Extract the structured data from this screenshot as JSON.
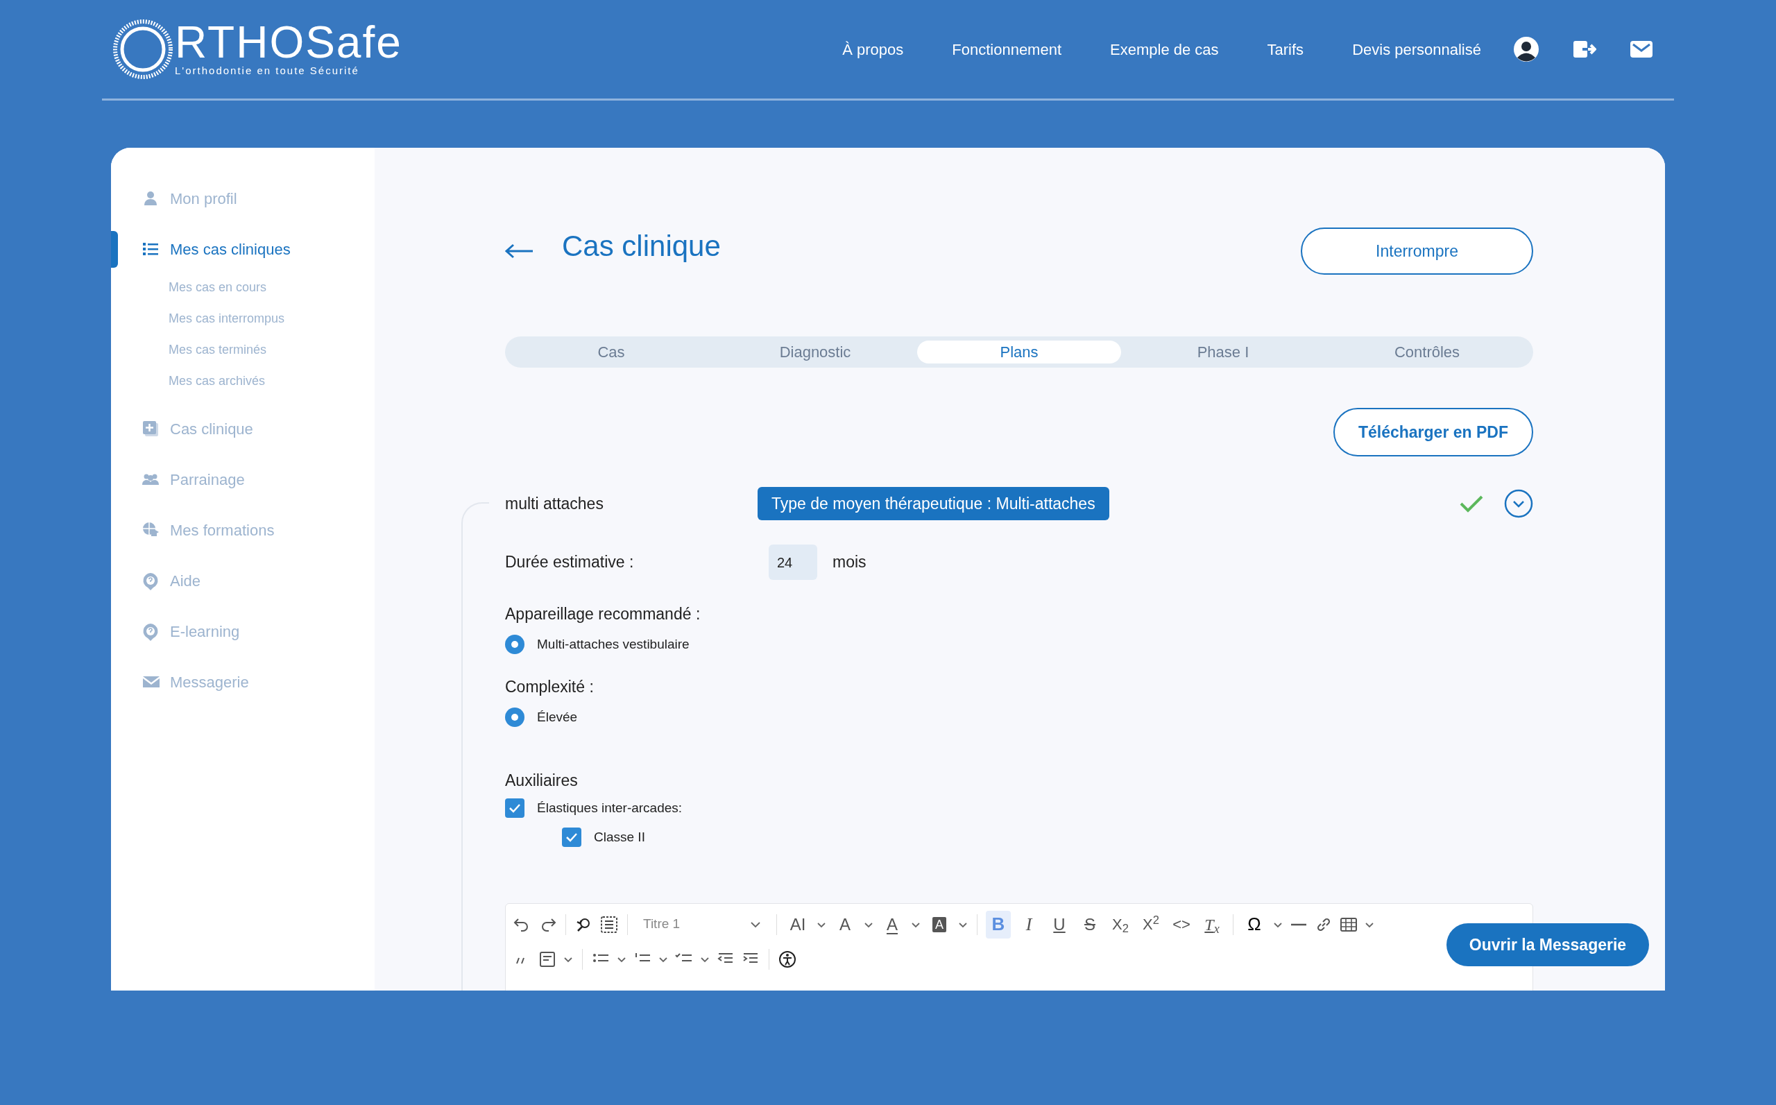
{
  "header": {
    "logo": {
      "name": "RTHOSafe",
      "tagline": "L'orthodontie en toute Sécurité"
    },
    "nav": [
      "À propos",
      "Fonctionnement",
      "Exemple de cas",
      "Tarifs",
      "Devis personnalisé"
    ]
  },
  "sidebar": {
    "items": [
      {
        "kind": "profile",
        "label": "Mon profil",
        "selected": false
      },
      {
        "kind": "cases",
        "label": "Mes cas cliniques",
        "selected": true,
        "children": [
          {
            "label": "Mes cas en cours"
          },
          {
            "label": "Mes cas interrompus"
          },
          {
            "label": "Mes cas terminés"
          },
          {
            "label": "Mes cas archivés"
          }
        ]
      },
      {
        "kind": "new-case",
        "label": "Cas clinique",
        "selected": false
      },
      {
        "kind": "referral",
        "label": "Parrainage",
        "selected": false
      },
      {
        "kind": "training",
        "label": "Mes formations",
        "selected": false
      },
      {
        "kind": "help",
        "label": "Aide",
        "selected": false
      },
      {
        "kind": "elearning",
        "label": "E-learning",
        "selected": false
      },
      {
        "kind": "messages",
        "label": "Messagerie",
        "selected": false
      }
    ]
  },
  "page": {
    "title": "Cas clinique",
    "interrupt_button": "Interrompre",
    "pdf_button": "Télécharger en PDF"
  },
  "tabs": [
    {
      "label": "Cas",
      "selected": false
    },
    {
      "label": "Diagnostic",
      "selected": false
    },
    {
      "label": "Plans",
      "selected": true
    },
    {
      "label": "Phase I",
      "selected": false
    },
    {
      "label": "Contrôles",
      "selected": false
    }
  ],
  "plan": {
    "title": "multi attaches",
    "badge": "Type de moyen thérapeutique : Multi-attaches",
    "validated": true,
    "duration": {
      "label": "Durée estimative :",
      "value": "24",
      "unit": "mois"
    },
    "appliance": {
      "label": "Appareillage recommandé :",
      "options": [
        {
          "label": "Multi-attaches vestibulaire",
          "selected": true
        }
      ]
    },
    "complexity": {
      "label": "Complexité :",
      "options": [
        {
          "label": "Élevée",
          "selected": true
        }
      ]
    },
    "auxiliaries": {
      "label": "Auxiliaires",
      "items": [
        {
          "label": "Élastiques inter-arcades:",
          "checked": true,
          "children": [
            {
              "label": "Classe II",
              "checked": true
            }
          ]
        }
      ]
    }
  },
  "editor": {
    "rows": [
      [
        {
          "kind": "undo"
        },
        {
          "kind": "redo"
        },
        {
          "kind": "sep"
        },
        {
          "kind": "find"
        },
        {
          "kind": "selectall"
        },
        {
          "kind": "sep"
        },
        {
          "kind": "format",
          "text": "Titre 1"
        },
        {
          "kind": "sep"
        },
        {
          "kind": "fontsize",
          "text": "AI"
        },
        {
          "kind": "caret"
        },
        {
          "kind": "lineheight",
          "text": "A"
        },
        {
          "kind": "caret"
        },
        {
          "kind": "fontcolor",
          "text": "A"
        },
        {
          "kind": "caret"
        },
        {
          "kind": "highlight",
          "text": "A"
        },
        {
          "kind": "caret"
        },
        {
          "kind": "sep"
        },
        {
          "kind": "bold",
          "text": "B",
          "active": true
        },
        {
          "kind": "italic",
          "text": "I",
          "active": false
        },
        {
          "kind": "underline",
          "text": "U",
          "active": false
        },
        {
          "kind": "strike",
          "text": "S",
          "active": false
        },
        {
          "kind": "script",
          "text": "X$_{2}$",
          "active": false
        },
        {
          "kind": "script",
          "text": "X$^{2}$",
          "active": false
        },
        {
          "kind": "code",
          "text": "<>",
          "active": false
        },
        {
          "kind": "clear",
          "text": "T$_{x}$",
          "active": false
        },
        {
          "kind": "sep"
        },
        {
          "kind": "omega",
          "text": "Ω"
        },
        {
          "kind": "caret"
        },
        {
          "kind": "rule"
        },
        {
          "kind": "link"
        },
        {
          "kind": "table"
        },
        {
          "kind": "caret"
        }
      ],
      [
        {
          "kind": "quote"
        },
        {
          "kind": "template"
        },
        {
          "kind": "caret"
        },
        {
          "kind": "sep"
        },
        {
          "kind": "bullets"
        },
        {
          "kind": "caret"
        },
        {
          "kind": "numbers"
        },
        {
          "kind": "caret"
        },
        {
          "kind": "checklist"
        },
        {
          "kind": "caret"
        },
        {
          "kind": "outdent"
        },
        {
          "kind": "indent"
        },
        {
          "kind": "sep"
        },
        {
          "kind": "accessibility"
        }
      ]
    ]
  },
  "chat_button": "Ouvrir la Messagerie"
}
